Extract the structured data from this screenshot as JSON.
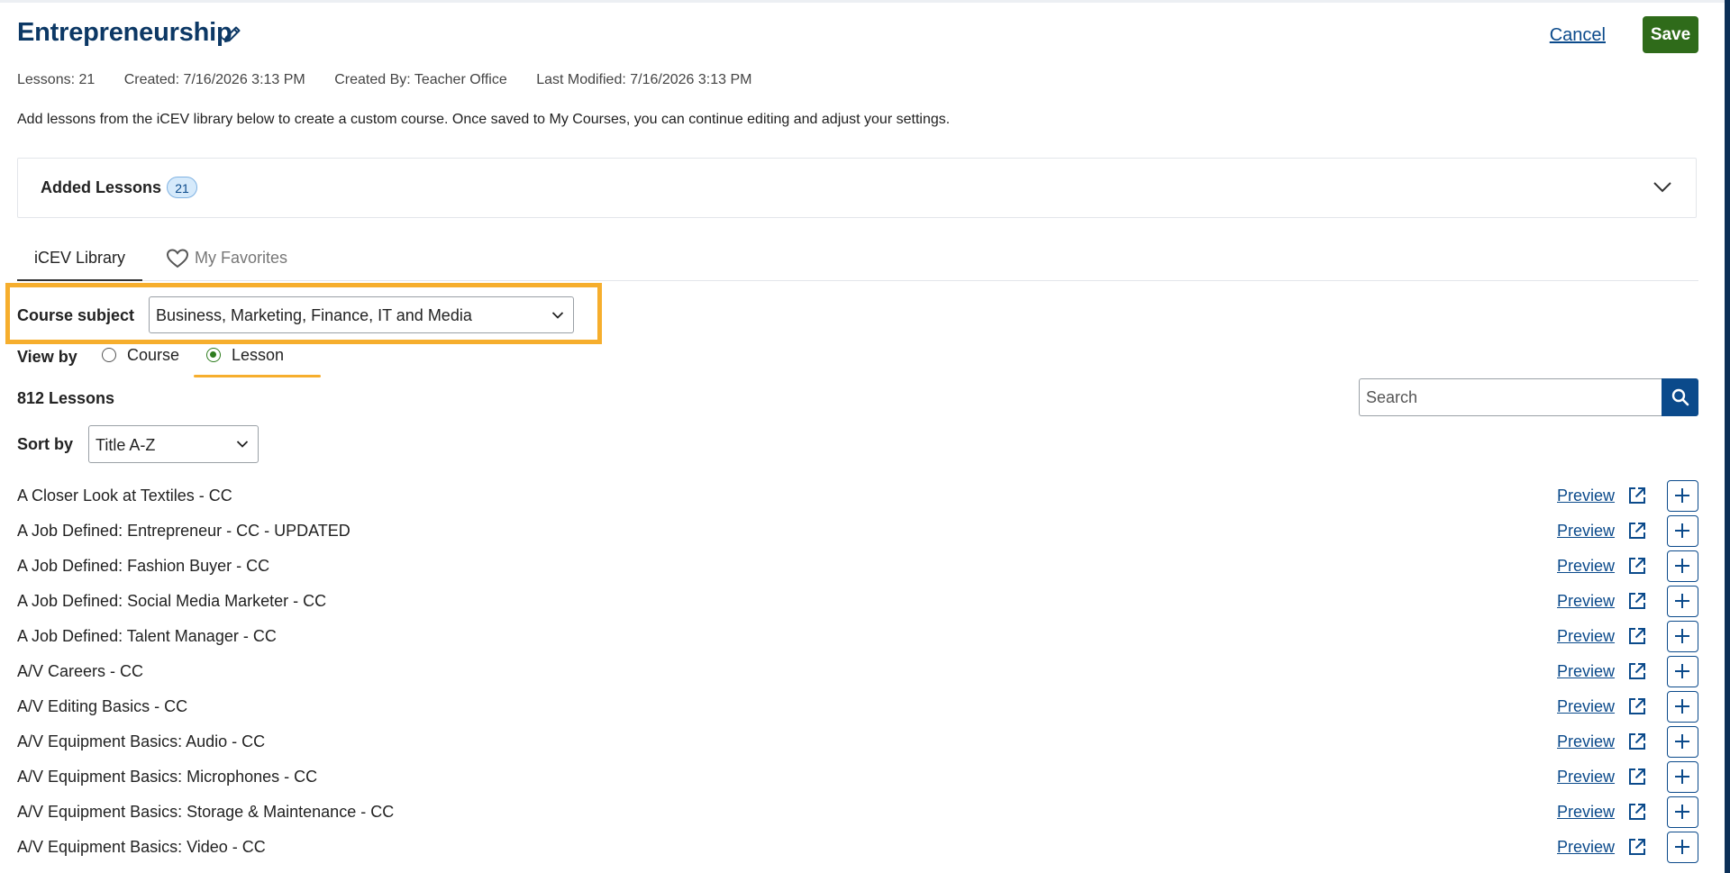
{
  "header": {
    "title": "Entrepreneurship",
    "cancel_label": "Cancel",
    "save_label": "Save"
  },
  "meta": {
    "lessons": "Lessons: 21",
    "created": "Created: 7/16/2026 3:13 PM",
    "created_by": "Created By: Teacher Office",
    "last_modified": "Last Modified: 7/16/2026 3:13 PM"
  },
  "description": "Add lessons from the iCEV library below to create a custom course. Once saved to My Courses, you can continue editing and adjust your settings.",
  "added_lessons": {
    "label": "Added Lessons",
    "count": "21"
  },
  "tabs": [
    {
      "label": "iCEV Library",
      "active": true
    },
    {
      "label": "My Favorites",
      "active": false
    }
  ],
  "filters": {
    "course_subject_label": "Course subject",
    "course_subject_value": "Business, Marketing, Finance, IT and Media",
    "view_by_label": "View by",
    "view_by_options": [
      "Course",
      "Lesson"
    ],
    "view_by_selected": "Lesson",
    "lesson_count": "812 Lessons",
    "search_placeholder": "Search",
    "sort_by_label": "Sort by",
    "sort_by_value": "Title A-Z"
  },
  "lessons": [
    {
      "title": "A Closer Look at Textiles - CC",
      "preview_label": "Preview"
    },
    {
      "title": "A Job Defined: Entrepreneur - CC - UPDATED",
      "preview_label": "Preview"
    },
    {
      "title": "A Job Defined: Fashion Buyer - CC",
      "preview_label": "Preview"
    },
    {
      "title": "A Job Defined: Social Media Marketer - CC",
      "preview_label": "Preview"
    },
    {
      "title": "A Job Defined: Talent Manager - CC",
      "preview_label": "Preview"
    },
    {
      "title": "A/V Careers - CC",
      "preview_label": "Preview"
    },
    {
      "title": "A/V Editing Basics - CC",
      "preview_label": "Preview"
    },
    {
      "title": "A/V Equipment Basics: Audio - CC",
      "preview_label": "Preview"
    },
    {
      "title": "A/V Equipment Basics: Microphones - CC",
      "preview_label": "Preview"
    },
    {
      "title": "A/V Equipment Basics: Storage & Maintenance - CC",
      "preview_label": "Preview"
    },
    {
      "title": "A/V Equipment Basics: Video - CC",
      "preview_label": "Preview"
    }
  ],
  "colors": {
    "title": "#0c3865",
    "save": "#2f6b1a",
    "link": "#0b4a8b",
    "highlight": "#f6ae2d",
    "radio_selected": "#2f7d1f"
  }
}
